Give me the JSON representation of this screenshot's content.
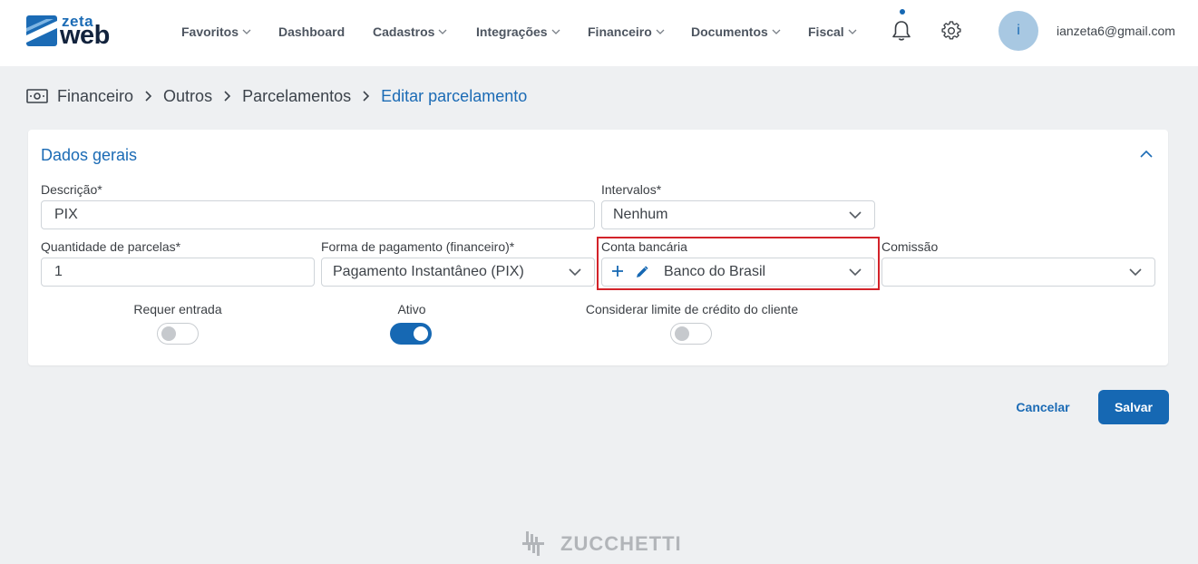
{
  "header": {
    "logo_top": "zeta",
    "logo_bottom": "web",
    "nav": [
      {
        "label": "Favoritos",
        "has_dropdown": true
      },
      {
        "label": "Dashboard",
        "has_dropdown": false
      },
      {
        "label": "Cadastros",
        "has_dropdown": true
      },
      {
        "label": "Integrações",
        "has_dropdown": true
      },
      {
        "label": "Financeiro",
        "has_dropdown": true
      },
      {
        "label": "Documentos",
        "has_dropdown": true
      },
      {
        "label": "Fiscal",
        "has_dropdown": true
      }
    ],
    "notifications_icon": "bell-icon",
    "settings_icon": "gear-icon",
    "avatar_initial": "i",
    "user_email": "ianzeta6@gmail.com"
  },
  "breadcrumb": {
    "icon": "money-icon",
    "items": [
      "Financeiro",
      "Outros",
      "Parcelamentos"
    ],
    "current": "Editar parcelamento"
  },
  "form": {
    "section_title": "Dados gerais",
    "descricao": {
      "label": "Descrição*",
      "value": "PIX"
    },
    "intervalos": {
      "label": "Intervalos*",
      "value": "Nenhum"
    },
    "quantidade": {
      "label": "Quantidade de parcelas*",
      "value": "1"
    },
    "forma_pagamento": {
      "label": "Forma de pagamento (financeiro)*",
      "value": "Pagamento Instantâneo (PIX)"
    },
    "conta_bancaria": {
      "label": "Conta bancária",
      "value": "Banco do Brasil"
    },
    "comissao": {
      "label": "Comissão",
      "value": ""
    },
    "requer_entrada": {
      "label": "Requer entrada",
      "checked": false
    },
    "ativo": {
      "label": "Ativo",
      "checked": true
    },
    "considerar_limite": {
      "label": "Considerar limite de crédito do cliente",
      "checked": false
    }
  },
  "actions": {
    "cancel_label": "Cancelar",
    "save_label": "Salvar"
  },
  "footer": {
    "brand": "ZUCCHETTI"
  },
  "colors": {
    "primary": "#1668b3",
    "highlight": "#d3232a",
    "background": "#eef0f2"
  }
}
